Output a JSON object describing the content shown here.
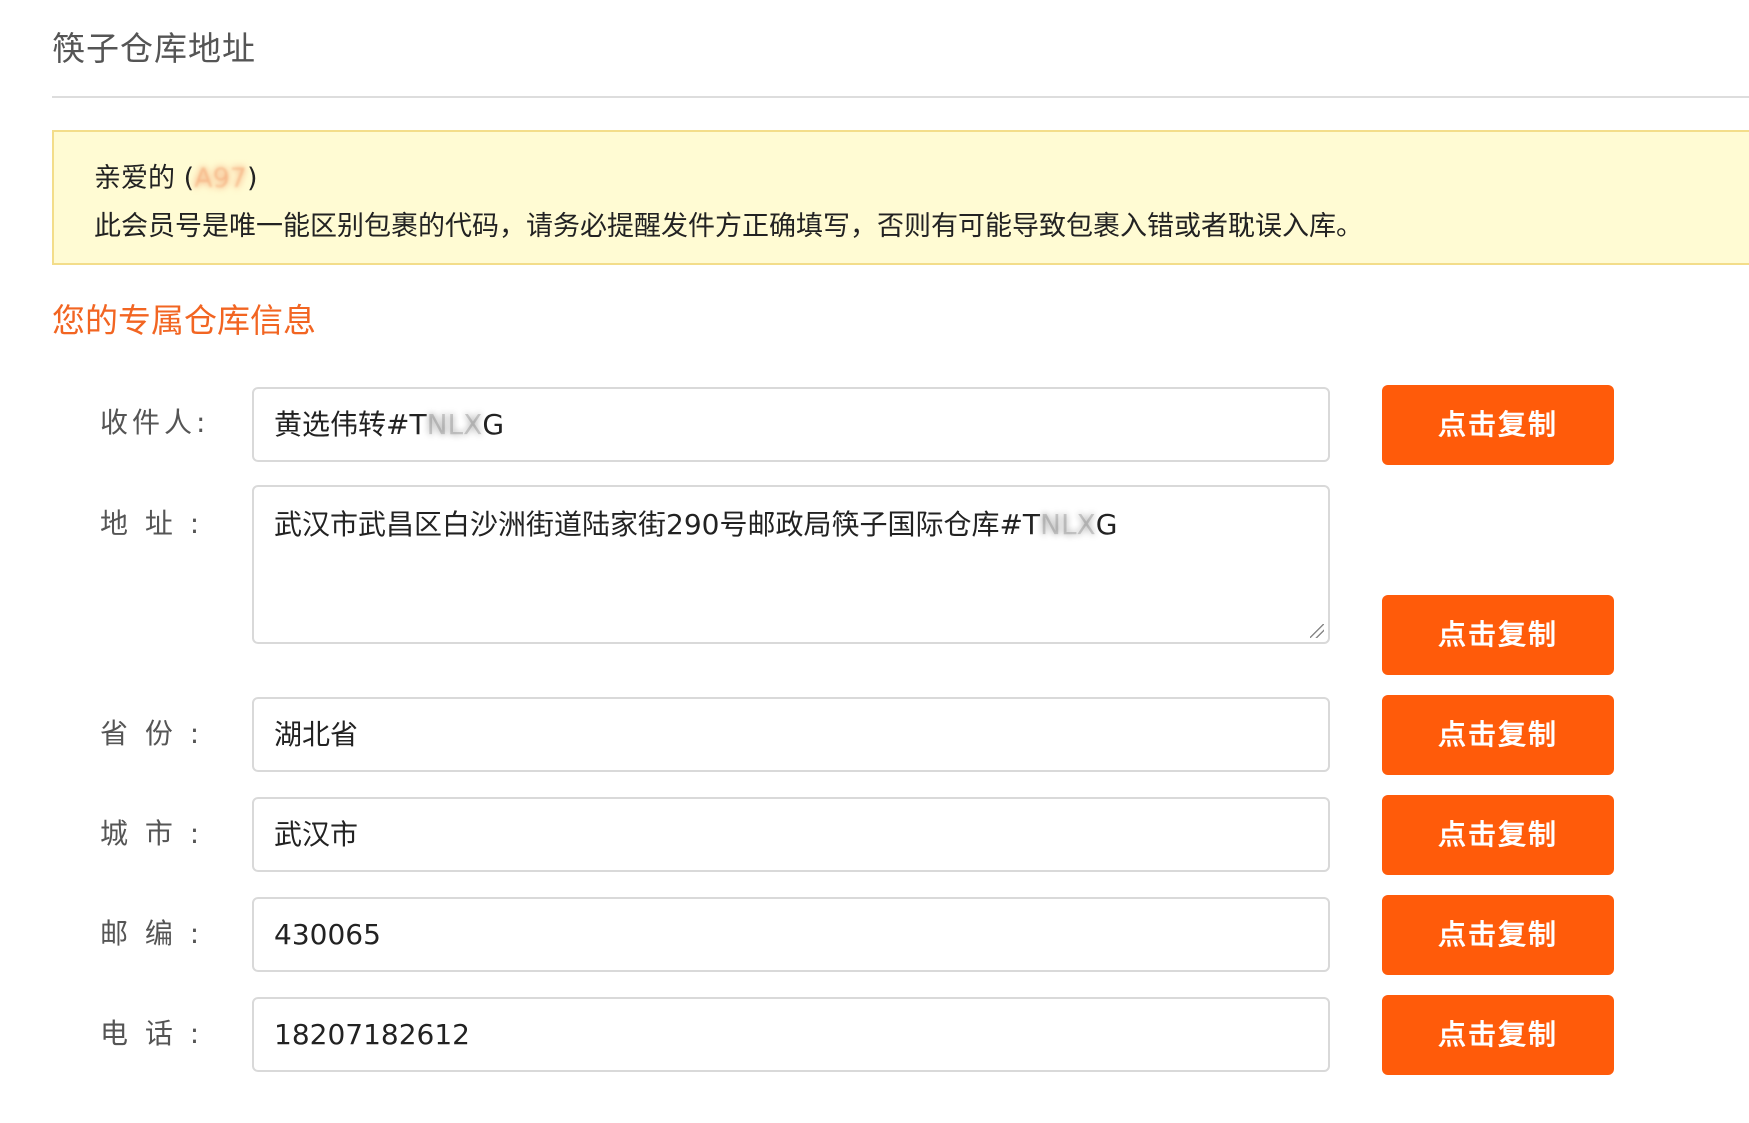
{
  "page_title": "筷子仓库地址",
  "notice": {
    "greeting_prefix": "亲爱的 (",
    "member_id_redacted": "A97",
    "greeting_suffix": ")",
    "message": "此会员号是唯一能区别包裹的代码，请务必提醒发件方正确填写，否则有可能导致包裹入错或者耽误入库。"
  },
  "section_title": "您的专属仓库信息",
  "fields": {
    "recipient": {
      "label": "收件人:",
      "value_prefix": "黄选伟转#T",
      "value_redacted": "NLX",
      "value_suffix": "G"
    },
    "address": {
      "label": "地 址 :",
      "value_prefix": "武汉市武昌区白沙洲街道陆家街290号邮政局筷子国际仓库#T",
      "value_redacted": "NLX",
      "value_suffix": "G"
    },
    "province": {
      "label": "省 份 :",
      "value": "湖北省"
    },
    "city": {
      "label": "城 市 :",
      "value": "武汉市"
    },
    "postcode": {
      "label": "邮 编 :",
      "value": "430065"
    },
    "phone": {
      "label": "电 话 :",
      "value": "18207182612"
    }
  },
  "copy_button_label": "点击复制",
  "colors": {
    "accent": "#ff5b0a",
    "section_title": "#f26522",
    "notice_bg": "#fffbd3",
    "notice_border": "#f3dd8a"
  }
}
